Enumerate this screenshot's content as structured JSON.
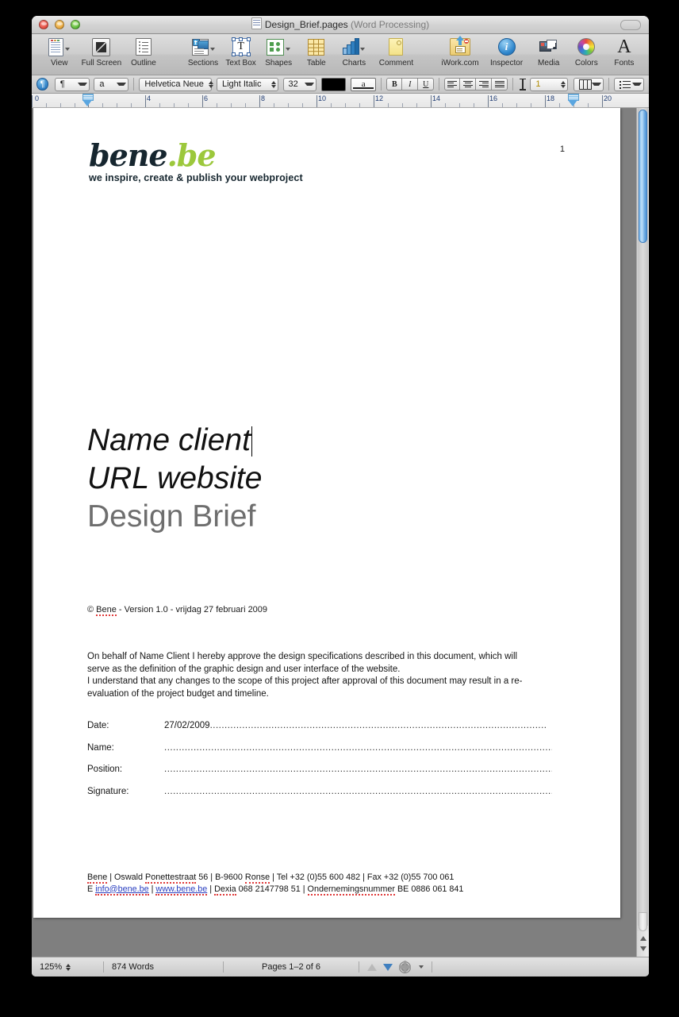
{
  "window": {
    "title": "Design_Brief.pages",
    "title_suffix": "(Word Processing)",
    "doc_icon": "pages-document-icon"
  },
  "toolbar": {
    "items": [
      {
        "label": "View",
        "icon": "view-icon",
        "has_menu": true
      },
      {
        "label": "Full Screen",
        "icon": "full-screen-icon",
        "has_menu": false
      },
      {
        "label": "Outline",
        "icon": "outline-icon",
        "has_menu": false
      },
      {
        "label": "Sections",
        "icon": "sections-icon",
        "has_menu": true
      },
      {
        "label": "Text Box",
        "icon": "text-box-icon",
        "has_menu": false
      },
      {
        "label": "Shapes",
        "icon": "shapes-icon",
        "has_menu": true
      },
      {
        "label": "Table",
        "icon": "table-icon",
        "has_menu": false
      },
      {
        "label": "Charts",
        "icon": "charts-icon",
        "has_menu": true
      },
      {
        "label": "Comment",
        "icon": "comment-icon",
        "has_menu": false
      },
      {
        "label": "iWork.com",
        "icon": "iwork-share-icon",
        "has_menu": false
      },
      {
        "label": "Inspector",
        "icon": "inspector-icon",
        "has_menu": false
      },
      {
        "label": "Media",
        "icon": "media-icon",
        "has_menu": false
      },
      {
        "label": "Colors",
        "icon": "colors-wheel-icon",
        "has_menu": false
      },
      {
        "label": "Fonts",
        "icon": "fonts-icon",
        "has_menu": false
      }
    ]
  },
  "formatbar": {
    "paragraph_style_button": "paragraph-style-icon",
    "paragraph_popup": "¶",
    "character_popup": "a",
    "font_family": "Helvetica Neue",
    "font_typeface": "Light Italic",
    "font_size": "32",
    "text_color": "#000000",
    "text_background": "a",
    "bold": "B",
    "italic": "I",
    "underline": "U",
    "line_spacing_value": "1",
    "columns_icon": "columns-icon",
    "list_icon": "list-icon"
  },
  "ruler": {
    "unit_numbers": [
      "0",
      "2",
      "4",
      "6",
      "8",
      "10",
      "12",
      "14",
      "16",
      "18",
      "20"
    ],
    "left_indent_marker": "left-indent-marker",
    "right_indent_marker": "right-indent-marker"
  },
  "document": {
    "page_number": "1",
    "logo": {
      "name_dark": "bene",
      "name_green": ".be",
      "tagline": "we inspire, create & publish your webproject",
      "color_dark": "#16262f",
      "color_green": "#9cc83c"
    },
    "title_lines": [
      {
        "text": "Name client",
        "style": "italic",
        "cursor_after": true
      },
      {
        "text": "URL website",
        "style": "italic",
        "cursor_after": false
      },
      {
        "text": "Design Brief",
        "style": "gray",
        "cursor_after": false
      }
    ],
    "copyright_prefix": "© ",
    "copyright_company": "Bene",
    "copyright_rest": " - Version 1.0 - vrijdag 27 februari 2009",
    "paragraph_lines": [
      "On behalf of Name Client I hereby approve the design specifications described in this document, which will",
      "serve as the definition of the graphic design and user interface of the website.",
      "I understand that any changes to the scope of this project after approval of this document may result in a re-",
      "evaluation of the project budget and timeline."
    ],
    "fields": [
      {
        "label": "Date:",
        "value": "27/02/2009",
        "dots": "..................................................................................................................."
      },
      {
        "label": "Name:",
        "value": "",
        "dots": "............................................................................................................................................."
      },
      {
        "label": "Position:",
        "value": "",
        "dots": "............................................................................................................................................."
      },
      {
        "label": "Signature:",
        "value": "",
        "dots": "............................................................................................................................................."
      }
    ],
    "footer": {
      "line1": {
        "company": "Bene",
        "sep1": " | Oswald ",
        "street": "Ponettestraat",
        "sep2": " 56 | B-9600 ",
        "city": "Ronse",
        "sep3": " | Tel +32 (0)55 600 482 | Fax +32 (0)55 700 061"
      },
      "line2": {
        "e_prefix": "E ",
        "email": "info@bene.be",
        "sep1": " |  ",
        "website": "www.bene.be",
        "sep2": " | ",
        "bank": "Dexia",
        "bank_num": " 068 2147798 51 | ",
        "vat_label": "Ondernemingsnummer",
        "vat_num": " BE 0886 061 841"
      }
    }
  },
  "statusbar": {
    "zoom": "125%",
    "word_count": "874 Words",
    "page_range": "Pages 1–2 of 6",
    "prev_page_icon": "page-up-icon",
    "next_page_icon": "page-down-icon",
    "settings_icon": "gear-icon"
  }
}
